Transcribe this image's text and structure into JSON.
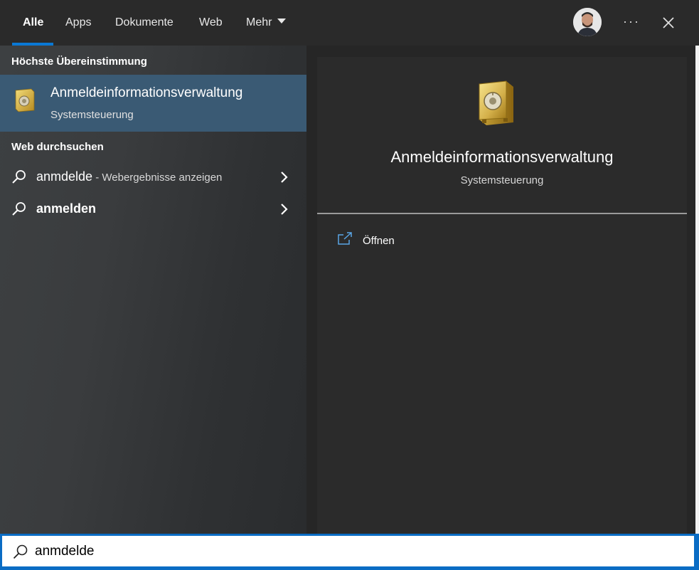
{
  "tabs": [
    {
      "label": "Alle",
      "active": true
    },
    {
      "label": "Apps",
      "active": false
    },
    {
      "label": "Dokumente",
      "active": false
    },
    {
      "label": "Web",
      "active": false
    },
    {
      "label": "Mehr",
      "active": false
    }
  ],
  "header": {
    "more_icon": "ellipsis-icon",
    "close_icon": "close-icon",
    "more_glyph": "···"
  },
  "best_match": {
    "heading": "Höchste Übereinstimmung",
    "title": "Anmeldeinformationsverwaltung",
    "subtitle": "Systemsteuerung",
    "icon": "safe-icon"
  },
  "web_search": {
    "heading": "Web durchsuchen",
    "items": [
      {
        "query": "anmdelde",
        "hint": " - Webergebnisse anzeigen"
      },
      {
        "query": "anmelden",
        "hint": ""
      }
    ]
  },
  "detail": {
    "title": "Anmeldeinformationsverwaltung",
    "subtitle": "Systemsteuerung",
    "actions": [
      {
        "label": "Öffnen",
        "icon": "open-icon"
      }
    ]
  },
  "search": {
    "value": "anmdelde"
  },
  "colors": {
    "accent": "#0a78d4",
    "selection": "#3a5a74"
  }
}
